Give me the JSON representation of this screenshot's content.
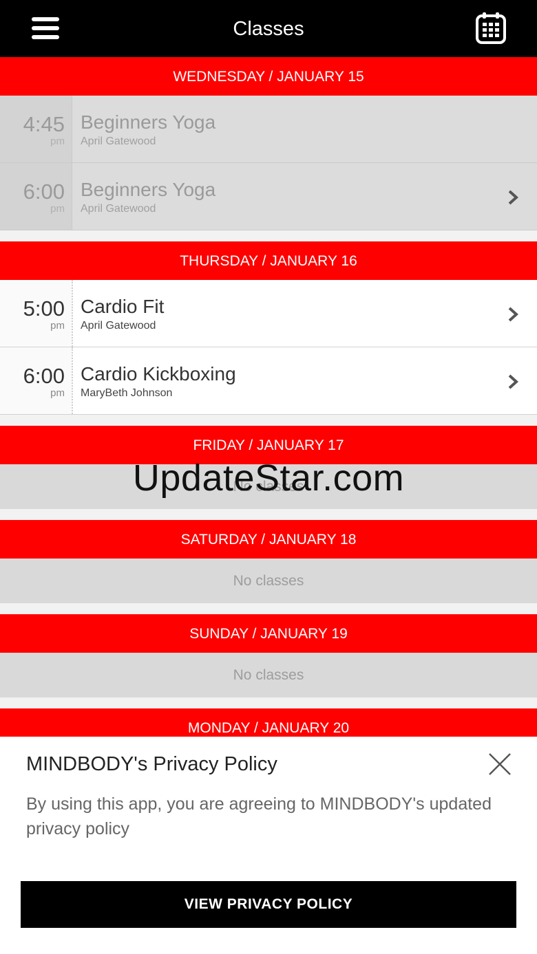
{
  "header": {
    "title": "Classes",
    "menu_icon": "hamburger-menu-icon",
    "calendar_icon": "calendar-icon"
  },
  "days": [
    {
      "label": "WEDNESDAY / JANUARY 15",
      "classes": [
        {
          "time": "4:45",
          "ampm": "pm",
          "name": "Beginners Yoga",
          "teacher": "April Gatewood",
          "past": true,
          "has_chevron": false
        },
        {
          "time": "6:00",
          "ampm": "pm",
          "name": "Beginners Yoga",
          "teacher": "April Gatewood",
          "past": true,
          "has_chevron": true
        }
      ]
    },
    {
      "label": "THURSDAY / JANUARY 16",
      "classes": [
        {
          "time": "5:00",
          "ampm": "pm",
          "name": "Cardio Fit",
          "teacher": "April Gatewood",
          "past": false,
          "has_chevron": true
        },
        {
          "time": "6:00",
          "ampm": "pm",
          "name": "Cardio Kickboxing",
          "teacher": "MaryBeth Johnson",
          "past": false,
          "has_chevron": true
        }
      ]
    },
    {
      "label": "FRIDAY / JANUARY 17",
      "empty_text": "No classes"
    },
    {
      "label": "SATURDAY / JANUARY 18",
      "empty_text": "No classes"
    },
    {
      "label": "SUNDAY / JANUARY 19",
      "empty_text": "No classes"
    },
    {
      "label": "MONDAY / JANUARY 20"
    }
  ],
  "watermark": "UpdateStar.com",
  "privacy": {
    "title": "MINDBODY's Privacy Policy",
    "text": "By using this app, you are agreeing to MINDBODY's updated privacy policy",
    "button_label": "VIEW PRIVACY POLICY",
    "close_icon": "close-icon"
  },
  "colors": {
    "accent": "#ff0000",
    "topbar": "#000000",
    "button": "#000000"
  }
}
